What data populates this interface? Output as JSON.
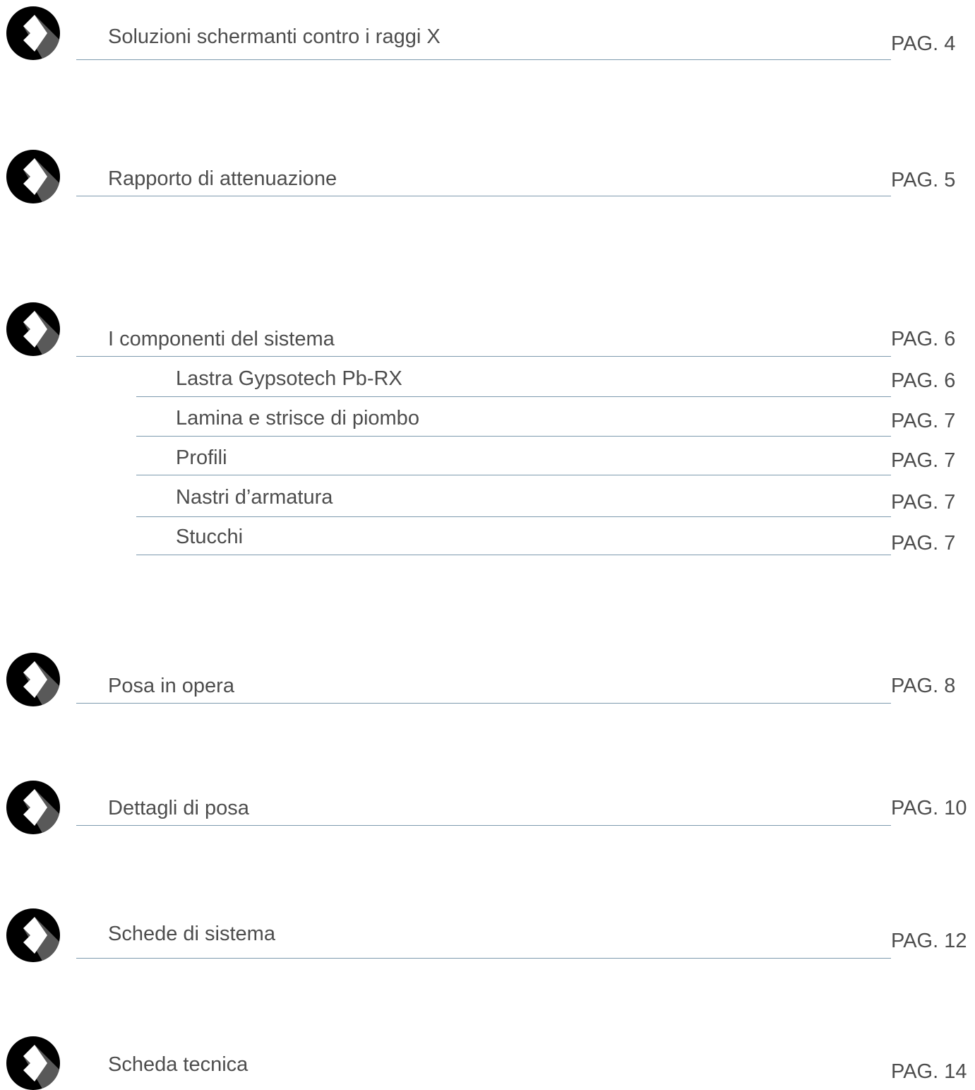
{
  "toc": {
    "entries": [
      {
        "label": "Soluzioni schermanti contro i raggi X",
        "page": "PAG. 4",
        "icon": "chevron-right-icon"
      },
      {
        "label": "Rapporto di attenuazione",
        "page": "PAG. 5",
        "icon": "chevron-right-icon"
      },
      {
        "label": "I componenti del sistema",
        "page": "PAG. 6",
        "icon": "chevron-right-icon",
        "subentries": [
          {
            "label": "Lastra Gypsotech Pb-RX",
            "page": "PAG. 6"
          },
          {
            "label": "Lamina e strisce di piombo",
            "page": "PAG. 7"
          },
          {
            "label": "Profili",
            "page": "PAG. 7"
          },
          {
            "label": "Nastri d’armatura",
            "page": "PAG. 7"
          },
          {
            "label": "Stucchi",
            "page": "PAG. 7"
          }
        ]
      },
      {
        "label": "Posa in opera",
        "page": "PAG. 8",
        "icon": "chevron-right-icon"
      },
      {
        "label": "Dettagli di posa",
        "page": "PAG. 10",
        "icon": "chevron-right-icon"
      },
      {
        "label": "Schede di sistema",
        "page": "PAG. 12",
        "icon": "chevron-right-icon"
      },
      {
        "label": "Scheda tecnica",
        "page": "PAG. 14",
        "icon": "chevron-right-icon"
      }
    ]
  },
  "colors": {
    "text": "#4d4d4d",
    "rule": "#7d9aae",
    "icon_circle": "#000000",
    "icon_shadow": "#595959",
    "icon_chevron": "#ffffff"
  }
}
